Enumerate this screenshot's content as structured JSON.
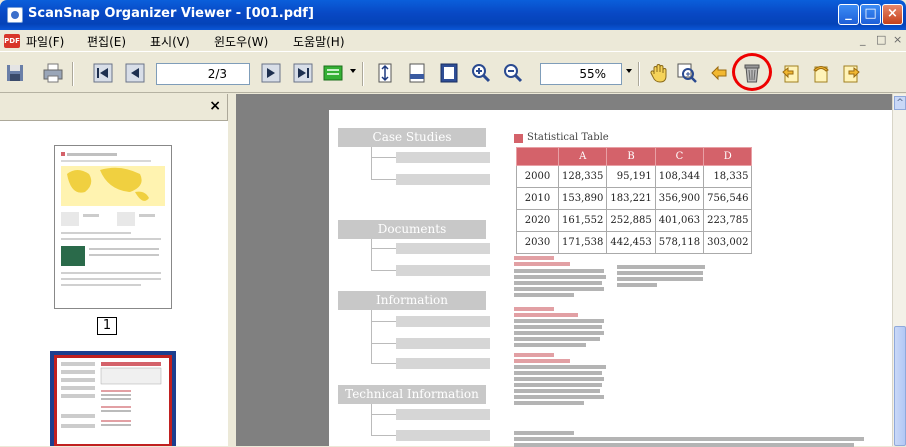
{
  "window": {
    "title": "ScanSnap Organizer Viewer - [001.pdf]",
    "buttons": [
      "minimize",
      "maximize",
      "close"
    ]
  },
  "menubar": {
    "items": [
      "파일(F)",
      "편집(E)",
      "표시(V)",
      "윈도우(W)",
      "도움말(H)"
    ],
    "mdi_buttons": [
      "_",
      "□",
      "×"
    ]
  },
  "toolbar": {
    "page_field": "2/3",
    "zoom_field": "55%",
    "icons": [
      "save-icon",
      "print-icon",
      "first-page-icon",
      "previous-page-icon",
      "next-page-icon",
      "last-page-icon",
      "color-icon",
      "fit-height-icon",
      "fit-width-icon",
      "fit-page-icon",
      "zoom-in-icon",
      "zoom-out-icon",
      "hand-tool-icon",
      "magnifier-tool-icon",
      "return-icon",
      "recycle-bin-icon",
      "rotate-left-icon",
      "rotate-180-icon",
      "rotate-right-icon"
    ],
    "highlighted_icon": "recycle-bin-icon",
    "highlight_color": "#E00000"
  },
  "sidebar": {
    "close_label": "×",
    "thumbnails": [
      {
        "page_label": "1"
      },
      {
        "page_label": "",
        "selected": true
      }
    ]
  },
  "document": {
    "sections": [
      "Case Studies",
      "Documents",
      "Information",
      "Technical Information"
    ],
    "table_title": "Statistical Table",
    "table_headers": [
      "",
      "A",
      "B",
      "C",
      "D"
    ],
    "table_rows": [
      [
        "2000",
        "128,335",
        "95,191",
        "108,344",
        "18,335"
      ],
      [
        "2010",
        "153,890",
        "183,221",
        "356,900",
        "756,546"
      ],
      [
        "2020",
        "161,552",
        "252,885",
        "401,063",
        "223,785"
      ],
      [
        "2030",
        "171,538",
        "442,453",
        "578,118",
        "303,002"
      ]
    ],
    "accent_color": "#D4626A"
  }
}
